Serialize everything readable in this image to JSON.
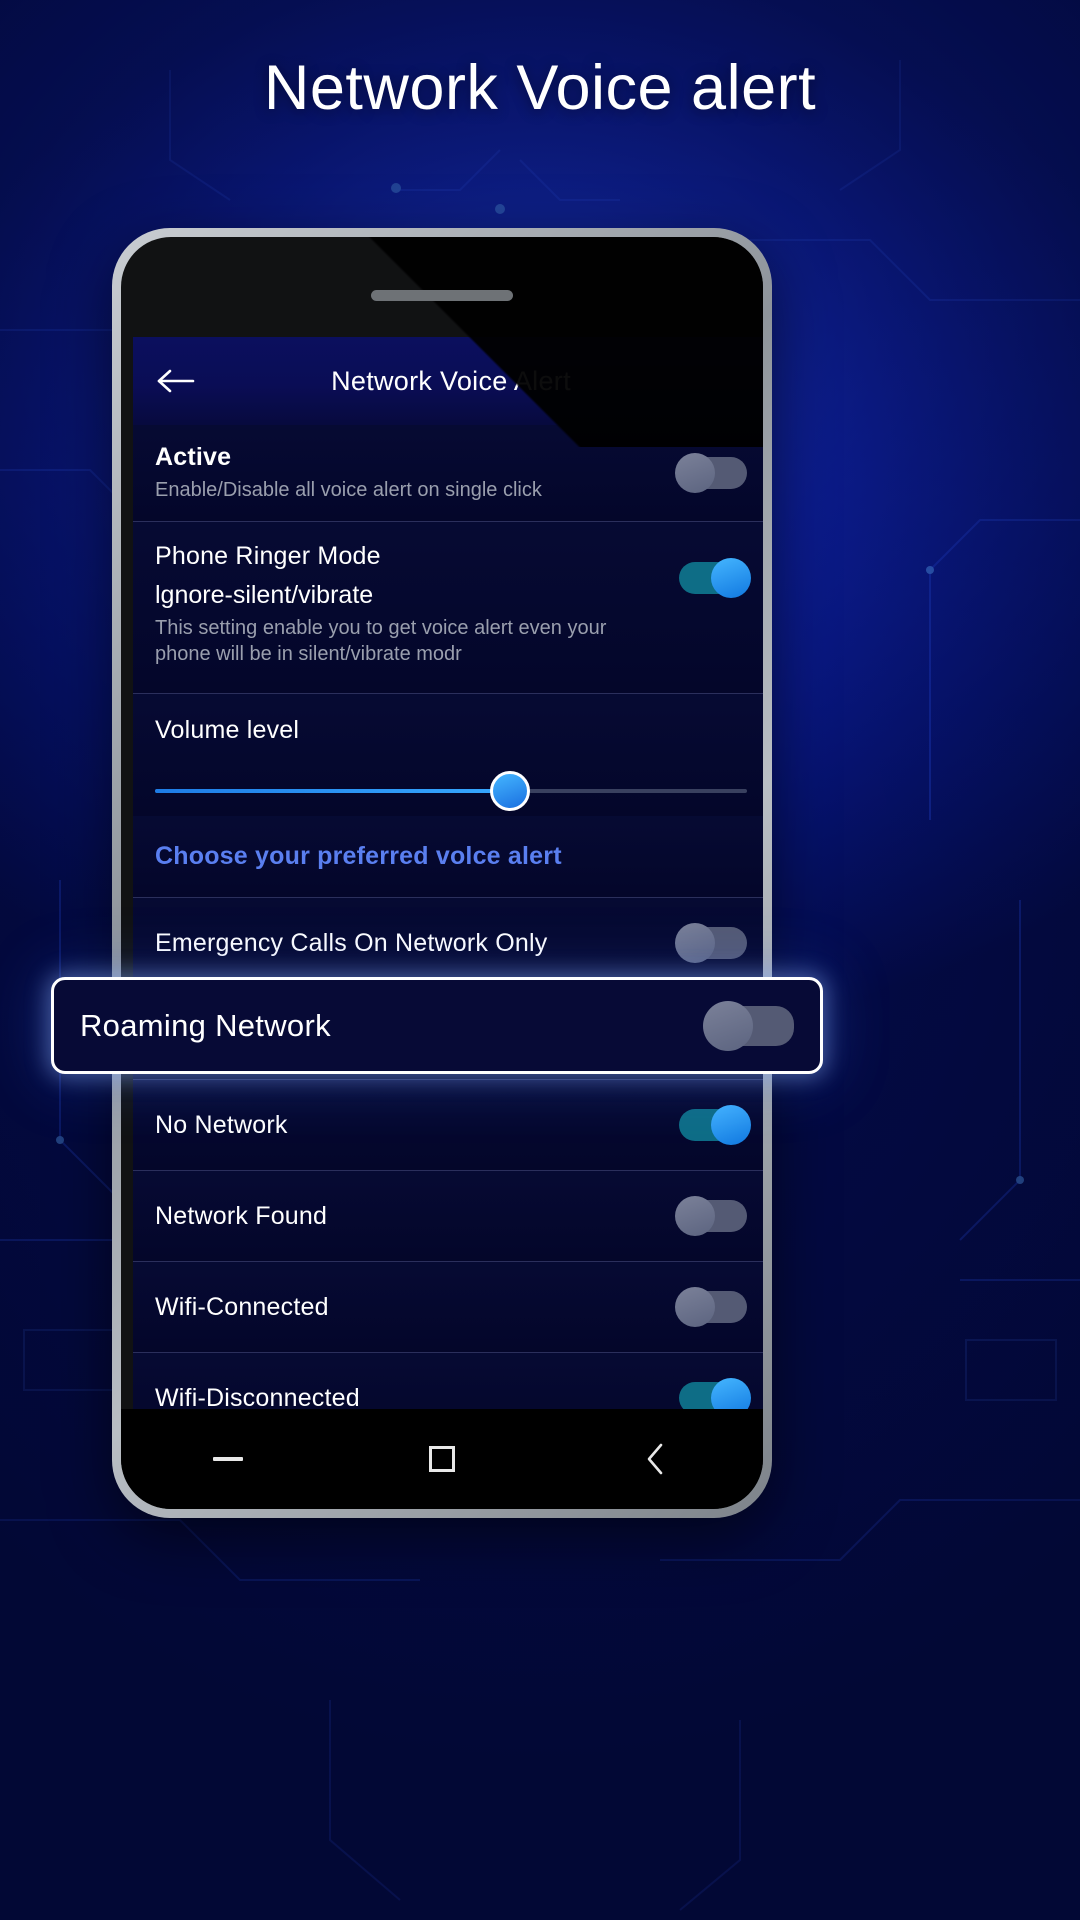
{
  "page": {
    "title": "Network Voice alert",
    "bg_accent": "#1a36c8"
  },
  "phone": {
    "appbar": {
      "back_icon": "arrow-left-icon",
      "title": "Network Voice Alert"
    },
    "rows": [
      {
        "id": "active",
        "title": "Active",
        "subtitle": "Enable/Disable all voice alert on single click",
        "toggle": "off"
      },
      {
        "id": "phone-ringer-mode",
        "title": "Phone Ringer Mode",
        "value": "lgnore-silent/vibrate",
        "subtitle": "This setting enable you to get voice alert even your phone will be in silent/vibrate modr",
        "toggle": "on"
      },
      {
        "id": "volume-level",
        "title": "Volume level",
        "slider_percent": 60
      },
      {
        "id": "choose-voice-alert",
        "link": "Choose your preferred volce alert"
      },
      {
        "id": "emergency-calls",
        "title": "Emergency Calls On Network Only",
        "toggle": "off"
      },
      {
        "id": "roaming-network",
        "title": "Roaming Network",
        "toggle": "off"
      },
      {
        "id": "no-network",
        "title": "No Network",
        "toggle": "on"
      },
      {
        "id": "network-found",
        "title": "Network Found",
        "toggle": "off"
      },
      {
        "id": "wifi-connected",
        "title": "Wifi-Connected",
        "toggle": "off"
      },
      {
        "id": "wifi-disconnected",
        "title": "Wifi-Disconnected",
        "toggle": "on"
      }
    ],
    "navbar": {
      "minimize_icon": "minimize-icon",
      "square_icon": "square-icon",
      "back_icon": "chevron-left-icon"
    }
  },
  "highlight": {
    "title": "Roaming Network",
    "toggle": "off",
    "border_color": "#ffffff"
  }
}
